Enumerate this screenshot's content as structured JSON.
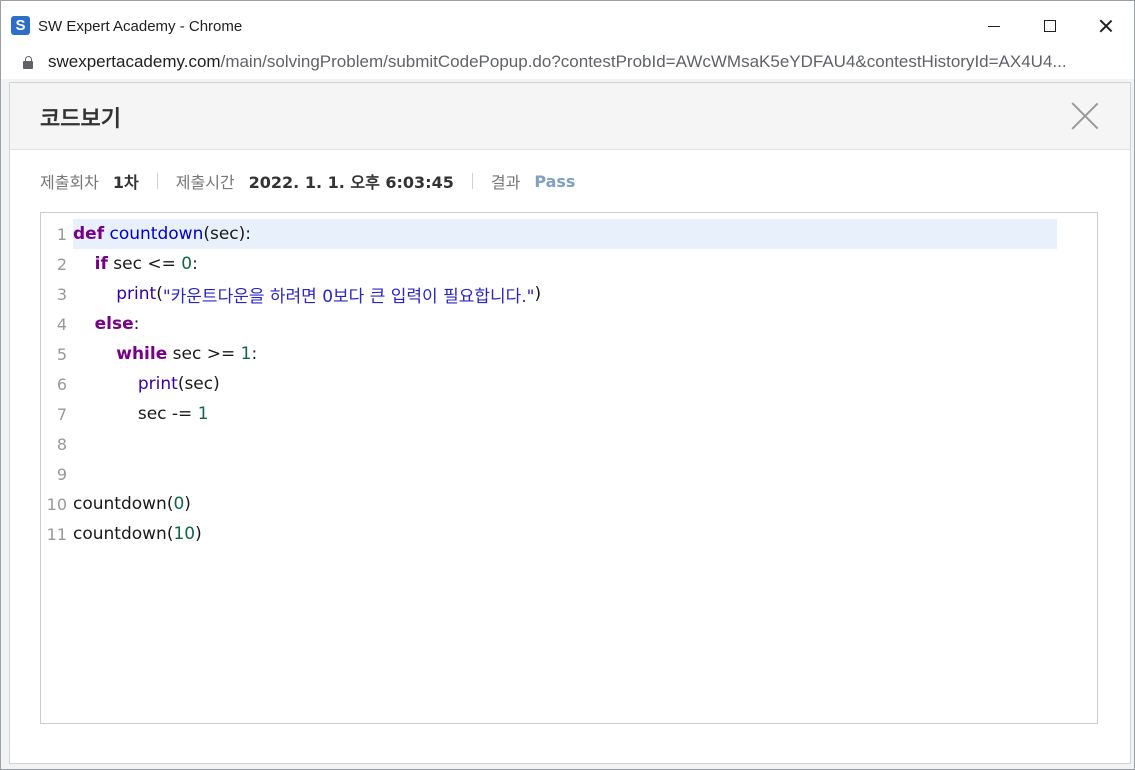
{
  "window": {
    "title": "SW Expert Academy - Chrome",
    "logo_letter": "S"
  },
  "address": {
    "host": "swexpertacademy.com",
    "path": "/main/solvingProblem/submitCodePopup.do?contestProbId=AWcWMsaK5eYDFAU4&contestHistoryId=AX4U4..."
  },
  "popup": {
    "title": "코드보기",
    "meta": {
      "submit_count_label": "제출회차",
      "submit_count_value": "1차",
      "submit_time_label": "제출시간",
      "submit_time_value": "2022. 1. 1. 오후 6:03:45",
      "result_label": "결과",
      "result_value": "Pass"
    }
  },
  "code": {
    "line_numbers": [
      "1",
      "2",
      "3",
      "4",
      "5",
      "6",
      "7",
      "8",
      "9",
      "10",
      "11"
    ],
    "lines": [
      {
        "parts": [
          {
            "t": "kw",
            "v": "def"
          },
          {
            "t": "code",
            "v": " "
          },
          {
            "t": "fn",
            "v": "countdown"
          },
          {
            "t": "code",
            "v": "(sec):"
          }
        ]
      },
      {
        "parts": [
          {
            "t": "code",
            "v": "    "
          },
          {
            "t": "kw",
            "v": "if"
          },
          {
            "t": "code",
            "v": " sec <= "
          },
          {
            "t": "num",
            "v": "0"
          },
          {
            "t": "code",
            "v": ":"
          }
        ]
      },
      {
        "parts": [
          {
            "t": "code",
            "v": "        "
          },
          {
            "t": "bi",
            "v": "print"
          },
          {
            "t": "code",
            "v": "("
          },
          {
            "t": "str",
            "v": "\"카운트다운을 하려면 0보다 큰 입력이 필요합니다.\""
          },
          {
            "t": "code",
            "v": ")"
          }
        ]
      },
      {
        "parts": [
          {
            "t": "code",
            "v": "    "
          },
          {
            "t": "kw",
            "v": "else"
          },
          {
            "t": "code",
            "v": ":"
          }
        ]
      },
      {
        "parts": [
          {
            "t": "code",
            "v": "        "
          },
          {
            "t": "kw",
            "v": "while"
          },
          {
            "t": "code",
            "v": " sec >= "
          },
          {
            "t": "num",
            "v": "1"
          },
          {
            "t": "code",
            "v": ":"
          }
        ]
      },
      {
        "parts": [
          {
            "t": "code",
            "v": "            "
          },
          {
            "t": "bi",
            "v": "print"
          },
          {
            "t": "code",
            "v": "(sec)"
          }
        ]
      },
      {
        "parts": [
          {
            "t": "code",
            "v": "            sec -= "
          },
          {
            "t": "num",
            "v": "1"
          }
        ]
      },
      {
        "parts": []
      },
      {
        "parts": []
      },
      {
        "parts": [
          {
            "t": "code",
            "v": "countdown("
          },
          {
            "t": "num",
            "v": "0"
          },
          {
            "t": "code",
            "v": ")"
          }
        ]
      },
      {
        "parts": [
          {
            "t": "code",
            "v": "countdown("
          },
          {
            "t": "num",
            "v": "10"
          },
          {
            "t": "code",
            "v": ")"
          }
        ]
      }
    ]
  },
  "colors": {
    "keyword": "#770088",
    "function": "#0000cc",
    "builtin": "#3300aa",
    "number": "#116644",
    "string": "#2d24c4",
    "pass": "#7fa0c4"
  },
  "icons": {
    "logo": "sw-expert-academy-logo",
    "lock": "lock-icon",
    "close": "close-icon"
  }
}
